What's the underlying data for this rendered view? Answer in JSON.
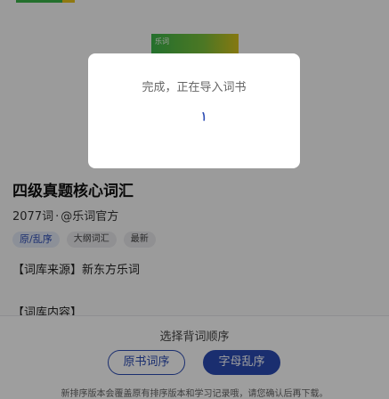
{
  "header": {
    "cover_tag": "乐词"
  },
  "book": {
    "title": "四级真题核心词汇",
    "word_count": "2077词",
    "dot": "·",
    "author": "@乐词官方",
    "tags": [
      "原/乱序",
      "大纲词汇",
      "最新"
    ],
    "source_line": "【词库来源】新东方乐词",
    "content_line": "【词库内容】"
  },
  "sheet": {
    "title": "选择背词顺序",
    "original_order_label": "原书词序",
    "shuffle_order_label": "字母乱序",
    "note": "新排序版本会覆盖原有排序版本和学习记录哦，请您确认后再下载。"
  },
  "dialog": {
    "message": "完成，正在导入词书",
    "spinner_icon": "loading-spinner-icon"
  },
  "colors": {
    "accent": "#2b4bb3",
    "cover_green": "#3bb54a",
    "cover_yellow": "#d8c21c",
    "overlay": "rgba(0,0,0,0.38)"
  }
}
